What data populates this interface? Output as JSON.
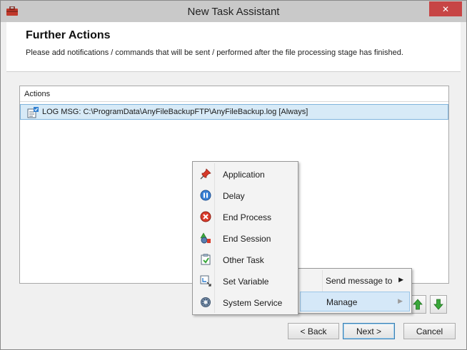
{
  "window": {
    "title": "New Task Assistant",
    "close_glyph": "✕",
    "app_icon": "toolbox-icon"
  },
  "header": {
    "title": "Further Actions",
    "description": "Please add notifications / commands that will be sent / performed after the file processing stage has finished."
  },
  "actions_list": {
    "column_header": "Actions",
    "rows": [
      {
        "icon": "log-message-icon",
        "text": "LOG MSG: C:\\ProgramData\\AnyFileBackupFTP\\AnyFileBackup.log [Always]",
        "selected": true
      }
    ]
  },
  "context_menu": {
    "items": [
      {
        "label": "Application",
        "icon": "pushpin-icon"
      },
      {
        "label": "Delay",
        "icon": "pause-icon"
      },
      {
        "label": "End Process",
        "icon": "stop-icon"
      },
      {
        "label": "End Session",
        "icon": "logoff-icon"
      },
      {
        "label": "Other Task",
        "icon": "task-icon"
      },
      {
        "label": "Set Variable",
        "icon": "variable-icon"
      },
      {
        "label": "System Service",
        "icon": "gear-icon"
      }
    ]
  },
  "submenu": {
    "items": [
      {
        "label": "Send message to",
        "arrow": "▶",
        "highlighted": false
      },
      {
        "label": "Manage",
        "arrow": "▶",
        "highlighted": true
      }
    ]
  },
  "buttons": {
    "move_up": "arrow-up-icon",
    "move_down": "arrow-down-icon",
    "back_label": "< Back",
    "next_label": "Next >",
    "cancel_label": "Cancel"
  },
  "colors": {
    "selection": "#d7eaf7",
    "close_button": "#c74545",
    "arrow_green": "#3aa83a"
  }
}
